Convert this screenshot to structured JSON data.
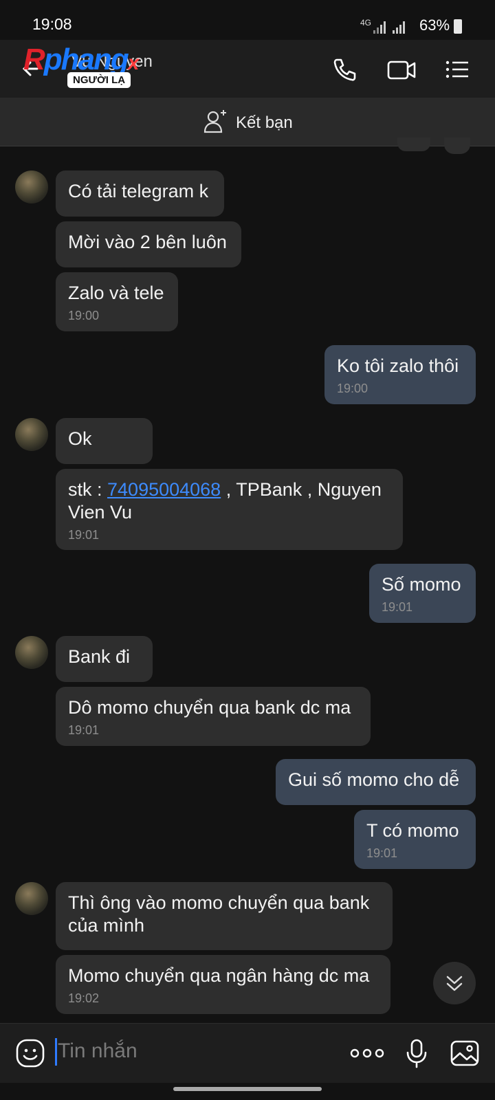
{
  "status_bar": {
    "time": "19:08",
    "network": "4G",
    "battery": "63%"
  },
  "header": {
    "logo_text": {
      "p1": "R",
      "p2": "phang",
      "p3": "x"
    },
    "contact_name": "Vu Nguyen",
    "badge": "NGƯỜI LẠ"
  },
  "friend_bar": {
    "label": "Kết bạn"
  },
  "messages": {
    "m1": "Có tải telegram k",
    "m2": "Mời vào 2 bên luôn",
    "m3": "Zalo và tele",
    "m3_time": "19:00",
    "m4": "Ko tôi zalo thôi",
    "m4_time": "19:00",
    "m5": "Ok",
    "m6_prefix": "stk : ",
    "m6_link": "74095004068",
    "m6_suffix": " , TPBank , Nguyen",
    "m6_line2": "Vien Vu",
    "m6_time": "19:01",
    "m7": "Số momo",
    "m7_time": "19:01",
    "m8": "Bank đi",
    "m9": "Dô momo chuyển qua bank dc ma",
    "m9_time": "19:01",
    "m10": "Gui số momo cho dễ",
    "m11": "T có momo",
    "m11_time": "19:01",
    "m12_line1": "Thì ông vào momo chuyển qua bank",
    "m12_line2": "của mình",
    "m13": "Momo chuyển qua ngân hàng dc ma",
    "m13_time": "19:02"
  },
  "input": {
    "placeholder": "Tin nhắn"
  },
  "icons": {
    "back": "back-arrow-icon",
    "call": "phone-icon",
    "video": "video-camera-icon",
    "menu": "menu-list-icon",
    "add_friend": "add-friend-icon",
    "emoji": "emoji-icon",
    "more": "more-dots-icon",
    "mic": "microphone-icon",
    "image": "image-icon",
    "scroll": "chevron-double-down-icon"
  },
  "colors": {
    "bg": "#121212",
    "incoming": "#2e2e2e",
    "outgoing": "#3b4656",
    "link": "#3d8bfd"
  }
}
